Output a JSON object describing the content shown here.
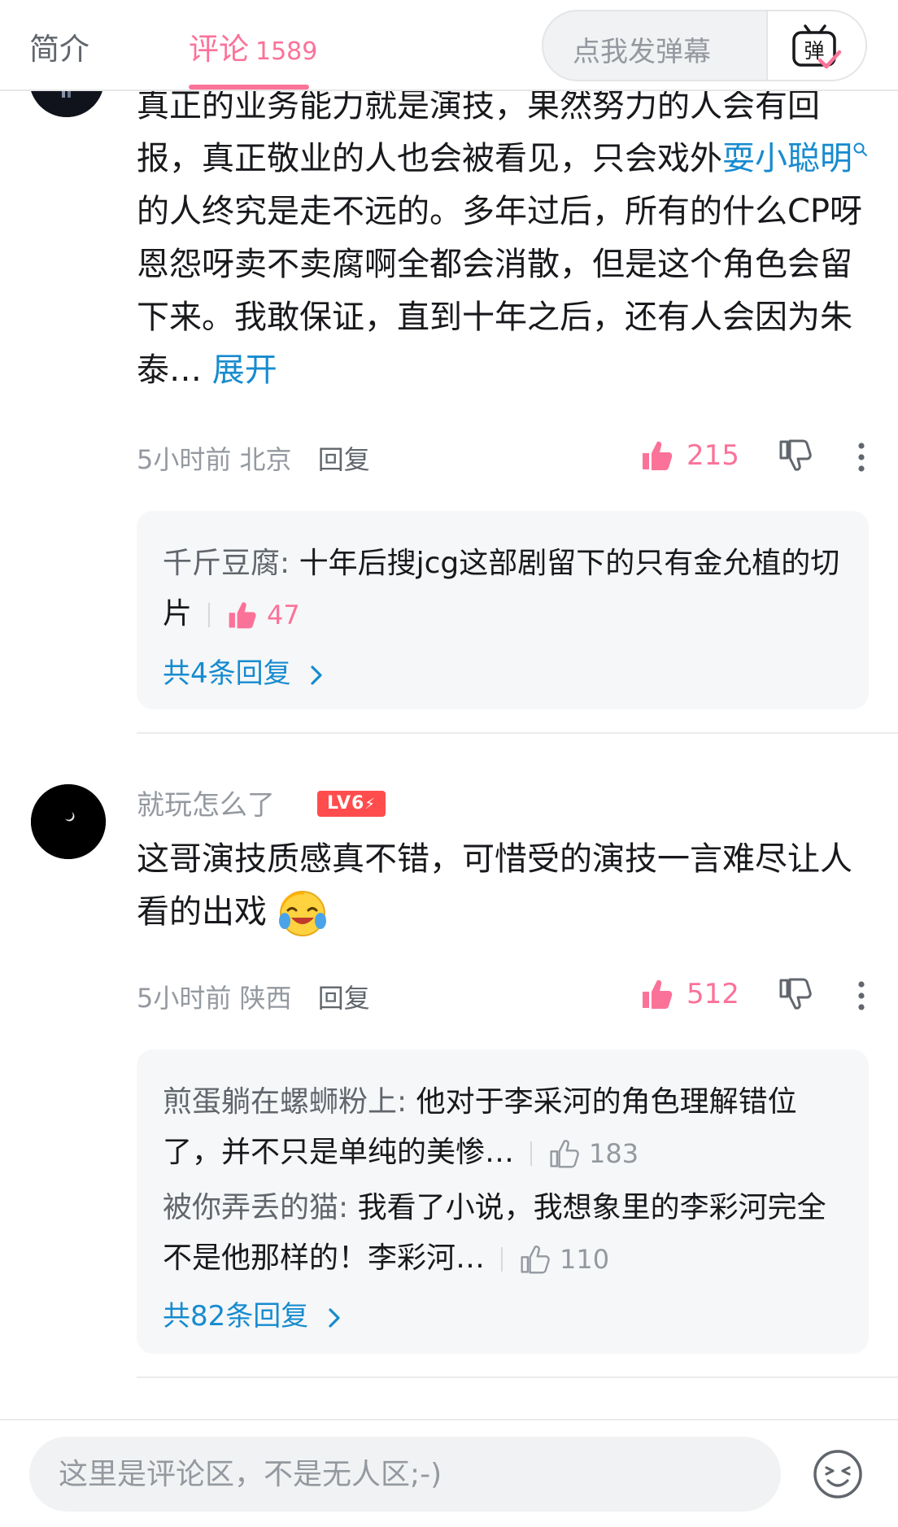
{
  "header": {
    "tab_intro": "简介",
    "tab_comments": "评论",
    "comments_count": "1589",
    "danmaku_placeholder": "点我发弹幕",
    "danmaku_button": "弹"
  },
  "comments": [
    {
      "text_before": "真正的业务能力就是演技，果然努力的人会有回报，真正敬业的人也会被看见，只会戏外",
      "keyword": "耍小聪明",
      "text_after": "的人终究是走不远的。多年过后，所有的什么CP呀恩怨呀卖不卖腐啊全都会消散，但是这个角色会留下来。我敢保证，直到十年之后，还有人会因为朱泰…",
      "expand": "展开",
      "time": "5小时前",
      "location": "北京",
      "reply_label": "回复",
      "likes": "215",
      "replies": [
        {
          "author": "千斤豆腐",
          "text": "十年后搜jcg这部剧留下的只有金允植的切片",
          "likes": "47",
          "liked": true
        }
      ],
      "total_replies": "共4条回复"
    },
    {
      "username": "就玩怎么了",
      "level": "LV6",
      "text": "这哥演技质感真不错，可惜受的演技一言难尽让人看的出戏",
      "time": "5小时前",
      "location": "陕西",
      "reply_label": "回复",
      "likes": "512",
      "replies": [
        {
          "author": "煎蛋躺在螺蛳粉上",
          "text": "他对于李采河的角色理解错位了，并不只是单纯的美惨…",
          "likes": "183",
          "liked": false
        },
        {
          "author": "被你弄丢的猫",
          "text": "我看了小说，我想象里的李彩河完全不是他那样的！李彩河…",
          "likes": "110",
          "liked": false
        }
      ],
      "total_replies": "共82条回复"
    }
  ],
  "footer": {
    "input_placeholder": "这里是评论区，不是无人区;-)"
  },
  "colors": {
    "accent": "#fb7299",
    "link": "#178bcf",
    "muted": "#9499a0",
    "level_badge": "#ff4d4d"
  }
}
